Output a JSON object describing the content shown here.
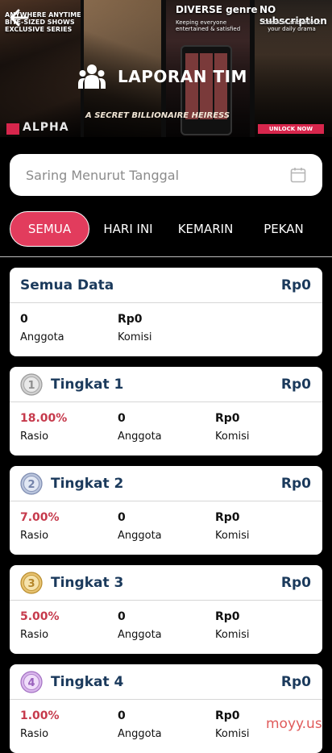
{
  "header": {
    "title": "LAPORAN TIM",
    "banner": {
      "panel1_text": "ANYWHERE ANYTIME BITE-SIZED SHOWS EXCLUSIVE SERIES",
      "panel1_movie": "ALPHA",
      "panel2_text": "A SECRET BILLIONAIRE HEIRESS",
      "panel3_title": "DIVERSE genre",
      "panel3_sub": "Keeping everyone entertained & satisfied",
      "panel4_title": "NO subscription",
      "panel4_sub": "Check in and unlock your daily drama",
      "panel4_button": "UNLOCK NOW"
    }
  },
  "filter": {
    "placeholder": "Saring Menurut Tanggal"
  },
  "tabs": [
    {
      "label": "SEMUA",
      "active": true
    },
    {
      "label": "HARI INI",
      "active": false
    },
    {
      "label": "KEMARIN",
      "active": false
    },
    {
      "label": "PEKAN",
      "active": false
    }
  ],
  "summary": {
    "name": "Semua Data",
    "amount": "Rp0",
    "members_value": "0",
    "members_label": "Anggota",
    "commission_value": "Rp0",
    "commission_label": "Komisi"
  },
  "levels": [
    {
      "name": "Tingkat 1",
      "amount": "Rp0",
      "ratio": "18.00%",
      "ratio_label": "Rasio",
      "members": "0",
      "members_label": "Anggota",
      "commission": "Rp0",
      "commission_label": "Komisi",
      "badge": "1"
    },
    {
      "name": "Tingkat 2",
      "amount": "Rp0",
      "ratio": "7.00%",
      "ratio_label": "Rasio",
      "members": "0",
      "members_label": "Anggota",
      "commission": "Rp0",
      "commission_label": "Komisi",
      "badge": "2"
    },
    {
      "name": "Tingkat 3",
      "amount": "Rp0",
      "ratio": "5.00%",
      "ratio_label": "Rasio",
      "members": "0",
      "members_label": "Anggota",
      "commission": "Rp0",
      "commission_label": "Komisi",
      "badge": "3"
    },
    {
      "name": "Tingkat 4",
      "amount": "Rp0",
      "ratio": "1.00%",
      "ratio_label": "Rasio",
      "members": "0",
      "members_label": "Anggota",
      "commission": "Rp0",
      "commission_label": "Komisi",
      "badge": "4"
    }
  ],
  "watermark": "moyy.us",
  "colors": {
    "accent": "#e23c5d",
    "navy": "#1b3a5c",
    "ratio_red": "#c63a4c"
  },
  "icons": {
    "back": "arrow-left-icon",
    "users": "users-icon",
    "calendar": "calendar-icon"
  }
}
